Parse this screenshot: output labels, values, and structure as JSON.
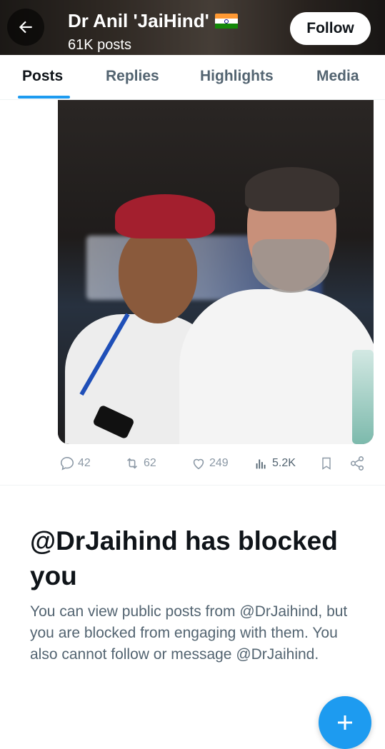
{
  "header": {
    "back_icon": "arrow-left-icon",
    "name": "Dr Anil 'JaiHind'",
    "flag_icon": "india-flag-icon",
    "post_count": "61K posts",
    "follow_label": "Follow"
  },
  "tabs": [
    {
      "label": "Posts",
      "active": true
    },
    {
      "label": "Replies",
      "active": false
    },
    {
      "label": "Highlights",
      "active": false
    },
    {
      "label": "Media",
      "active": false
    }
  ],
  "post": {
    "media_icon": "photo",
    "actions": {
      "replies": "42",
      "reposts": "62",
      "likes": "249",
      "views": "5.2K"
    }
  },
  "blocked": {
    "title": "@DrJaihind has blocked you",
    "description": "You can view public posts from @DrJaihind, but you are blocked from engaging with them. You also cannot follow or message @DrJaihind."
  },
  "fab": {
    "icon": "plus-icon"
  },
  "colors": {
    "accent": "#1d9bf0",
    "text_primary": "#0f1419",
    "text_secondary": "#536471",
    "flag_saffron": "#ff9933",
    "flag_green": "#138808"
  }
}
